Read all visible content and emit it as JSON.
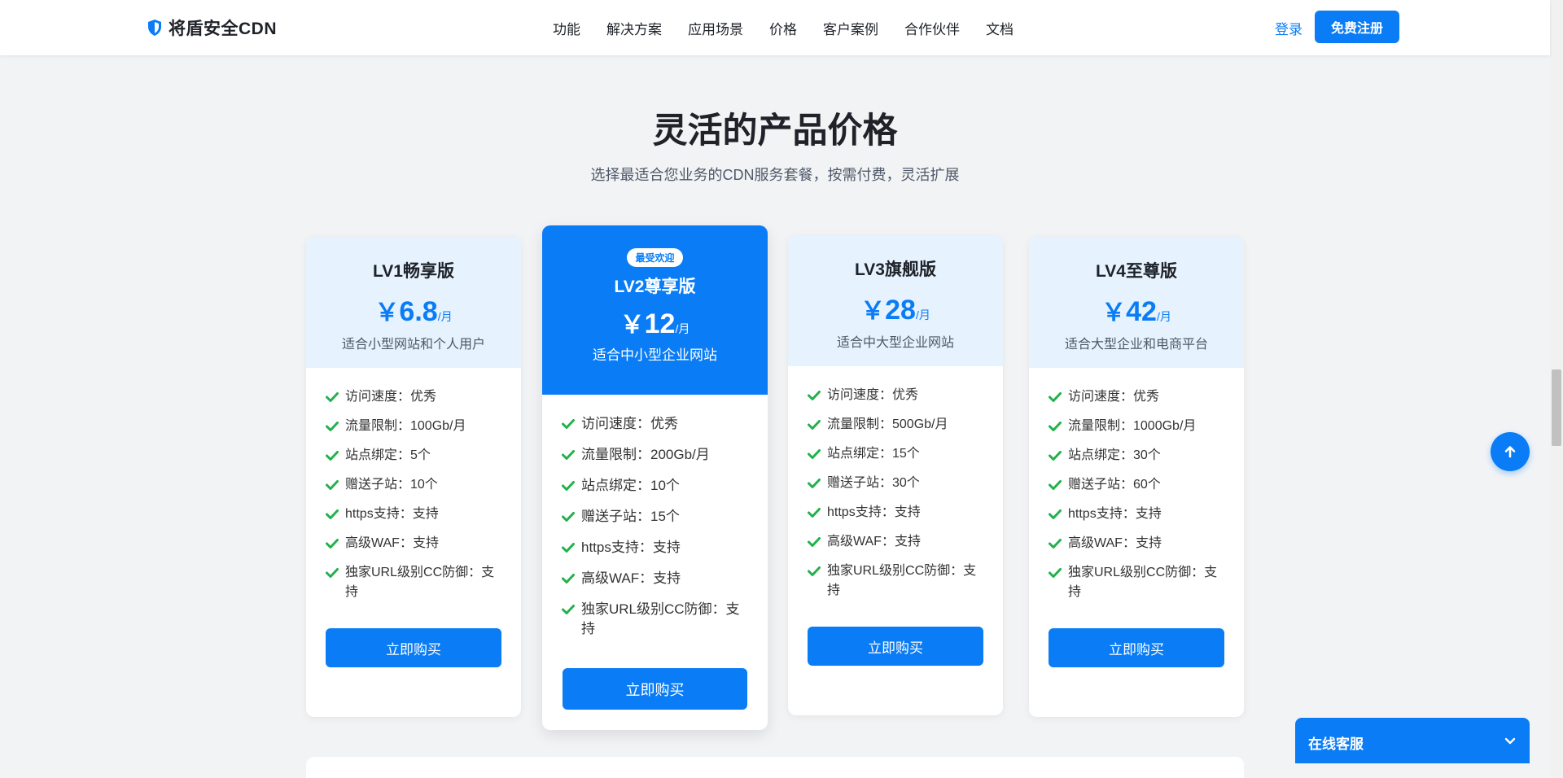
{
  "header": {
    "brand": "将盾安全CDN",
    "nav": [
      "功能",
      "解决方案",
      "应用场景",
      "价格",
      "客户案例",
      "合作伙伴",
      "文档"
    ],
    "login": "登录",
    "register": "免费注册"
  },
  "section": {
    "title": "灵活的产品价格",
    "subtitle": "选择最适合您业务的CDN服务套餐，按需付费，灵活扩展"
  },
  "plans": [
    {
      "name": "LV1畅享版",
      "currency": "￥",
      "price": "6.8",
      "unit": "/月",
      "desc": "适合小型网站和个人用户",
      "features": [
        "访问速度：优秀",
        "流量限制：100Gb/月",
        "站点绑定：5个",
        "赠送子站：10个",
        "https支持：支持",
        "高级WAF：支持",
        "独家URL级别CC防御：支持"
      ],
      "button": "立即购买"
    },
    {
      "badge": "最受欢迎",
      "name": "LV2尊享版",
      "currency": "￥",
      "price": "12",
      "unit": "/月",
      "desc": "适合中小型企业网站",
      "features": [
        "访问速度：优秀",
        "流量限制：200Gb/月",
        "站点绑定：10个",
        "赠送子站：15个",
        "https支持：支持",
        "高级WAF：支持",
        "独家URL级别CC防御：支持"
      ],
      "button": "立即购买"
    },
    {
      "name": "LV3旗舰版",
      "currency": "￥",
      "price": "28",
      "unit": "/月",
      "desc": "适合中大型企业网站",
      "features": [
        "访问速度：优秀",
        "流量限制：500Gb/月",
        "站点绑定：15个",
        "赠送子站：30个",
        "https支持：支持",
        "高级WAF：支持",
        "独家URL级别CC防御：支持"
      ],
      "button": "立即购买"
    },
    {
      "name": "LV4至尊版",
      "currency": "￥",
      "price": "42",
      "unit": "/月",
      "desc": "适合大型企业和电商平台",
      "features": [
        "访问速度：优秀",
        "流量限制：1000Gb/月",
        "站点绑定：30个",
        "赠送子站：60个",
        "https支持：支持",
        "高级WAF：支持",
        "独家URL级别CC防御：支持"
      ],
      "button": "立即购买"
    }
  ],
  "chat": {
    "label": "在线客服"
  },
  "colors": {
    "accent": "#0a7cf5",
    "check": "#22b14c",
    "background": "#f2f3f5"
  }
}
